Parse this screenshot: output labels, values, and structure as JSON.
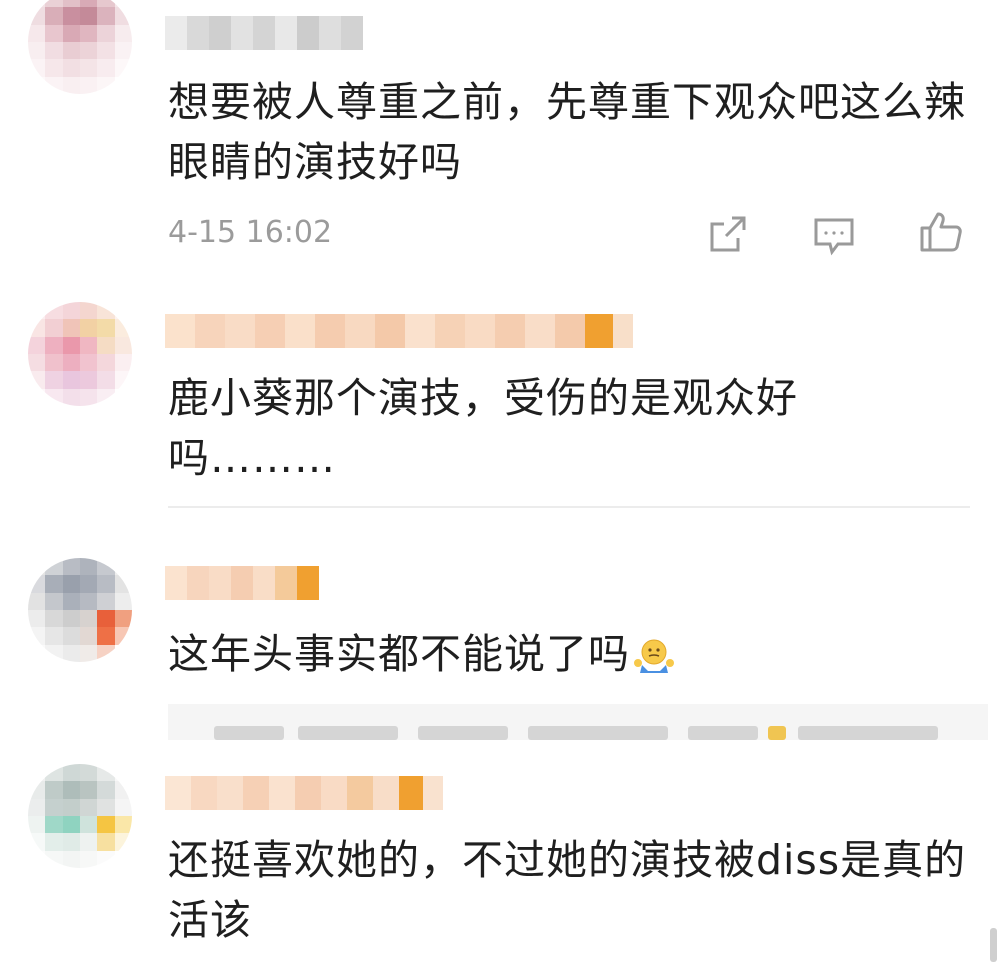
{
  "comments": [
    {
      "text": "想要被人尊重之前，先尊重下观众吧这么辣眼睛的演技好吗",
      "timestamp": "4-15 16:02",
      "actions": [
        "share-icon",
        "comment-icon",
        "like-icon"
      ]
    },
    {
      "text": "鹿小葵那个演技，受伤的是观众好吗………"
    },
    {
      "text": "这年头事实都不能说了吗",
      "emoji": "shrug-emoji"
    },
    {
      "text": "还挺喜欢她的，不过她的演技被diss是真的活该"
    }
  ],
  "colors": {
    "text": "#1f1f1f",
    "meta": "#9b9b9b",
    "divider": "#ececec",
    "accent_orange": "#f0a030"
  }
}
